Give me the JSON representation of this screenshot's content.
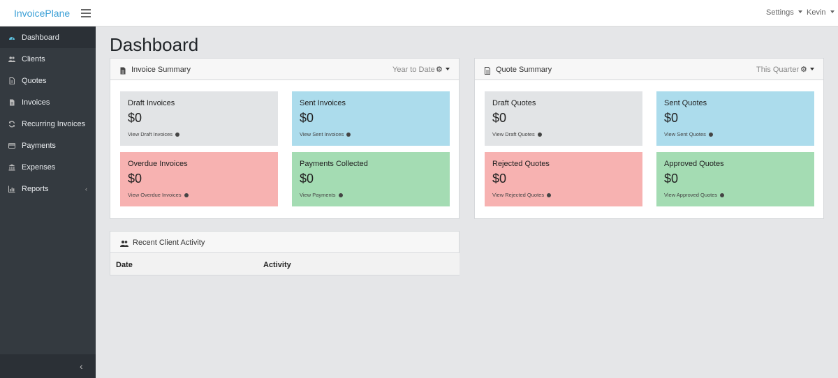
{
  "app": {
    "brand": "InvoicePlane",
    "settings_label": "Settings",
    "user_label": "Kevin"
  },
  "sidebar": {
    "items": [
      {
        "label": "Dashboard",
        "icon": "dashboard-icon",
        "active": true
      },
      {
        "label": "Clients",
        "icon": "users-icon"
      },
      {
        "label": "Quotes",
        "icon": "file-icon"
      },
      {
        "label": "Invoices",
        "icon": "file-text-icon"
      },
      {
        "label": "Recurring Invoices",
        "icon": "refresh-icon"
      },
      {
        "label": "Payments",
        "icon": "credit-card-icon"
      },
      {
        "label": "Expenses",
        "icon": "bank-icon"
      },
      {
        "label": "Reports",
        "icon": "bar-chart-icon",
        "has_submenu": true
      }
    ]
  },
  "page": {
    "title": "Dashboard"
  },
  "invoice_summary": {
    "title": "Invoice Summary",
    "period": "Year to Date",
    "cards": [
      {
        "title": "Draft Invoices",
        "amount": "$0",
        "link": "View Draft Invoices",
        "color": "#e2e4e6"
      },
      {
        "title": "Sent Invoices",
        "amount": "$0",
        "link": "View Sent Invoices",
        "color": "#acdcec"
      },
      {
        "title": "Overdue Invoices",
        "amount": "$0",
        "link": "View Overdue Invoices",
        "color": "#f7b2b1"
      },
      {
        "title": "Payments Collected",
        "amount": "$0",
        "link": "View Payments",
        "color": "#a4dcb3"
      }
    ]
  },
  "quote_summary": {
    "title": "Quote Summary",
    "period": "This Quarter",
    "cards": [
      {
        "title": "Draft Quotes",
        "amount": "$0",
        "link": "View Draft Quotes",
        "color": "#e2e4e6"
      },
      {
        "title": "Sent Quotes",
        "amount": "$0",
        "link": "View Sent Quotes",
        "color": "#acdcec"
      },
      {
        "title": "Rejected Quotes",
        "amount": "$0",
        "link": "View Rejected Quotes",
        "color": "#f7b2b1"
      },
      {
        "title": "Approved Quotes",
        "amount": "$0",
        "link": "View Approved Quotes",
        "color": "#a4dcb3"
      }
    ]
  },
  "recent_activity": {
    "title": "Recent Client Activity",
    "columns": [
      "Date",
      "Activity"
    ]
  }
}
